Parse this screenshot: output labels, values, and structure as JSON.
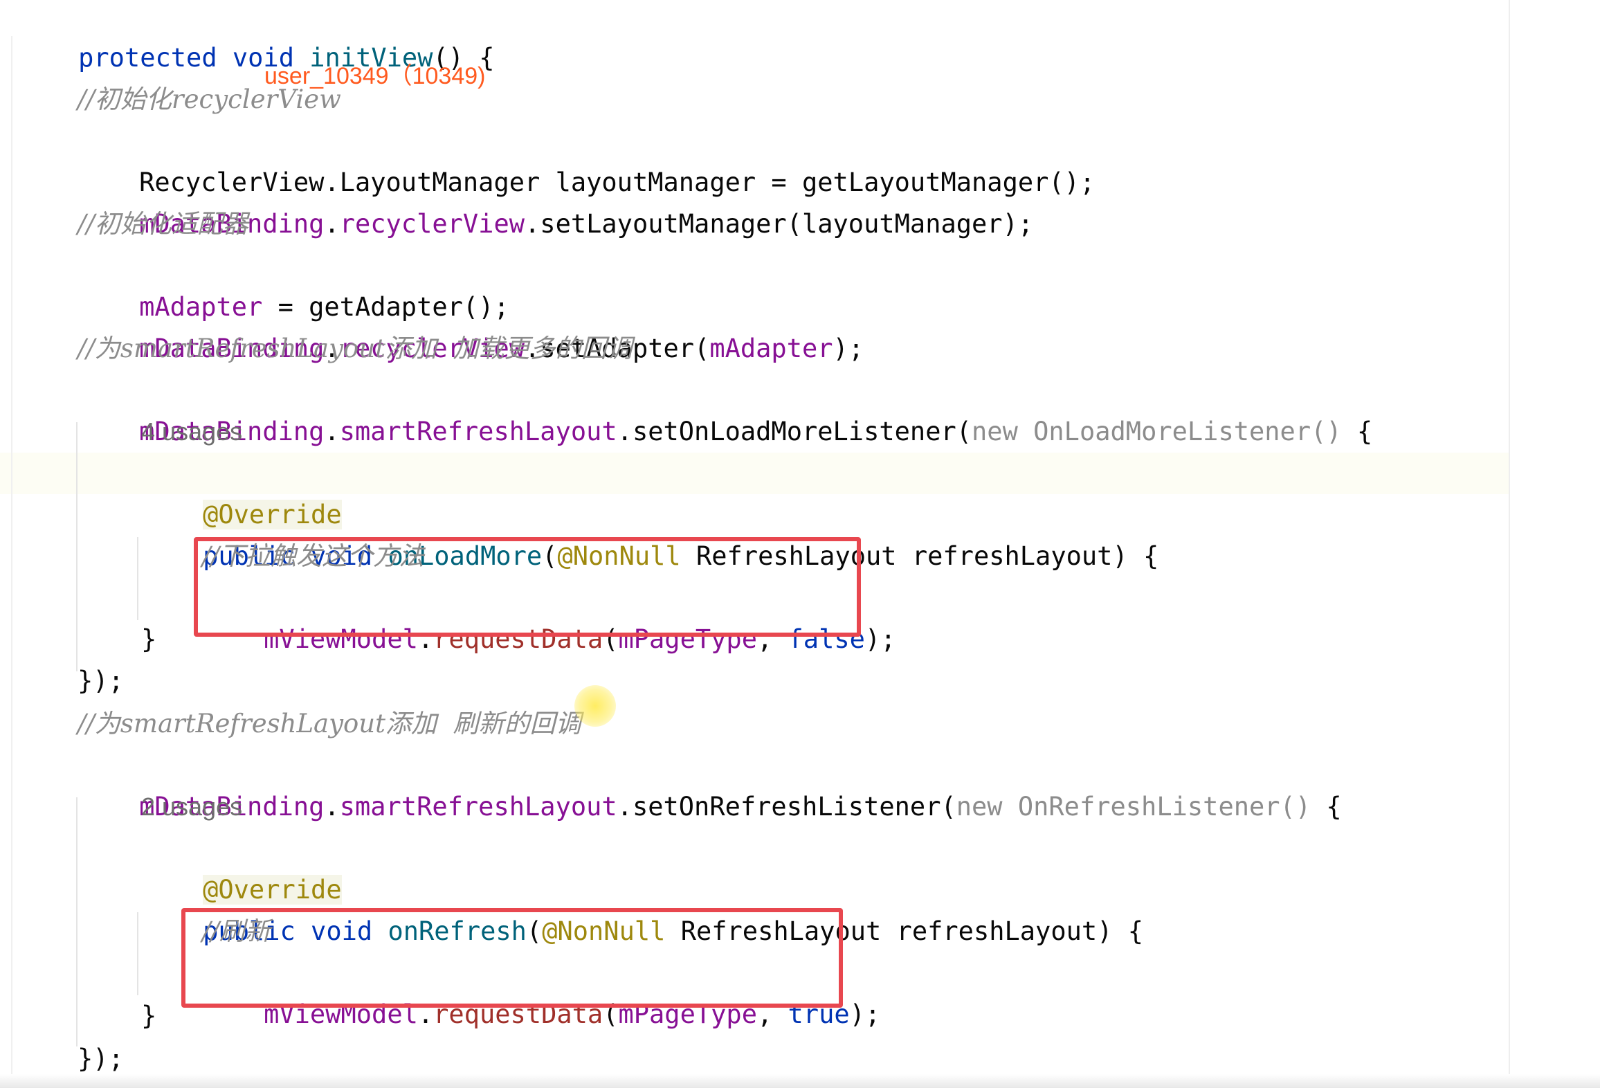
{
  "watermark": "user_10349（10349)",
  "line1": {
    "kw1": "protected",
    "kw2": "void",
    "fn": "initView",
    "rest": "() {"
  },
  "comment_init_recycler": "//初始化recyclerView",
  "line_layout_manager": {
    "type": "RecyclerView.LayoutManager",
    "rest": " layoutManager = getLayoutManager();"
  },
  "line_set_layout": {
    "field1": "mDataBinding",
    "dot1": ".",
    "field2": "recyclerView",
    "rest": ".setLayoutManager(layoutManager);"
  },
  "comment_init_adapter": "//初始化适配器",
  "line_adapter": {
    "field": "mAdapter",
    "rest": " = getAdapter();"
  },
  "line_set_adapter": {
    "field1": "mDataBinding",
    "dot1": ".",
    "field2": "recyclerView",
    "mid": ".setAdapter(",
    "field3": "mAdapter",
    "end": ");"
  },
  "comment_load_more": "//为smartRefreshLayout添加  加载更多的回调",
  "line_load_more_listener": {
    "field1": "mDataBinding",
    "dot1": ".",
    "field2": "smartRefreshLayout",
    "mid": ".setOnLoadMoreListener(",
    "new_kw": "new",
    "cls": " OnLoadMoreListener()",
    "end": " {"
  },
  "usages_load_more": "4 usages",
  "override1": "@Override",
  "line_on_load_more": {
    "kw1": "public",
    "kw2": "void",
    "fn": "onLoadMore",
    "open": "(",
    "anno": "@NonNull",
    "rest": " RefreshLayout refreshLayout) {"
  },
  "comment_pull": "//下拉触发这个方法",
  "line_request_false": {
    "field1": "mViewModel",
    "dot": ".",
    "call": "requestData",
    "open": "(",
    "field2": "mPageType",
    "comma": ", ",
    "bool": "false",
    "end": ");"
  },
  "close_brace_1": "}",
  "close_listener_1": "});",
  "comment_refresh_cb": "//为smartRefreshLayout添加  刷新的回调",
  "line_refresh_listener": {
    "field1": "mDataBinding",
    "dot1": ".",
    "field2": "smartRefreshLayout",
    "mid": ".setOnRefreshListener(",
    "new_kw": "new",
    "cls": " OnRefreshListener()",
    "end": " {"
  },
  "usages_refresh": "2 usages",
  "override2": "@Override",
  "line_on_refresh": {
    "kw1": "public",
    "kw2": "void",
    "fn": "onRefresh",
    "open": "(",
    "anno": "@NonNull",
    "rest": " RefreshLayout refreshLayout) {"
  },
  "comment_refresh": "//刷新",
  "line_request_true": {
    "field1": "mViewModel",
    "dot": ".",
    "call": "requestData",
    "open": "(",
    "field2": "mPageType",
    "comma": ", ",
    "bool": "true",
    "end": ");"
  },
  "close_brace_2": "}",
  "close_listener_2": "});",
  "colors": {
    "highlight_border": "#e8474f",
    "keyword": "#0033b3",
    "field": "#871094",
    "comment": "#8c8c8c",
    "watermark": "#ff5a1f"
  }
}
